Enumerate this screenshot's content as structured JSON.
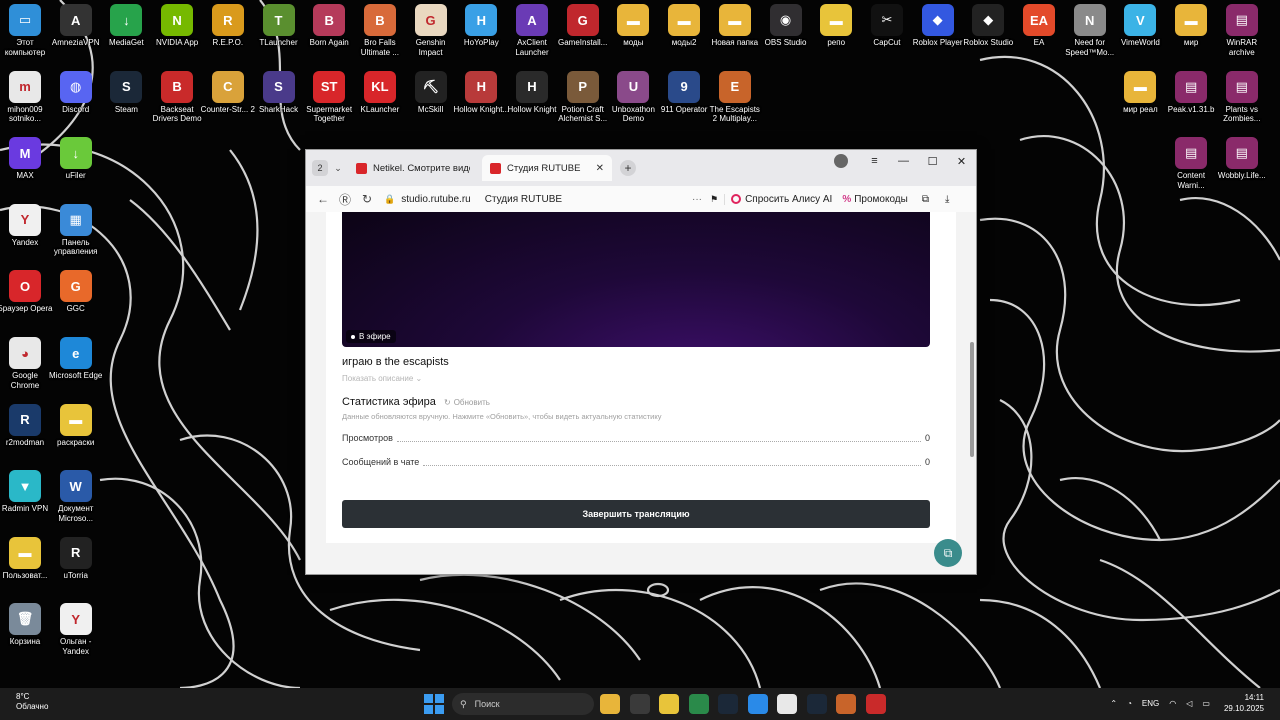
{
  "desktop_icons": [
    {
      "label": "Этот компьютер",
      "color": "#2f8fd8",
      "glyph": "▭",
      "col": 0,
      "row": 0
    },
    {
      "label": "AmneziaVPN",
      "color": "#333",
      "glyph": "A",
      "col": 1,
      "row": 0
    },
    {
      "label": "MediaGet",
      "color": "#27a34b",
      "glyph": "↓",
      "col": 2,
      "row": 0
    },
    {
      "label": "NVIDIA App",
      "color": "#76b900",
      "glyph": "N",
      "col": 3,
      "row": 0
    },
    {
      "label": "R.E.P.O.",
      "color": "#d99a1c",
      "glyph": "R",
      "col": 4,
      "row": 0
    },
    {
      "label": "TLauncher",
      "color": "#5a8f2f",
      "glyph": "T",
      "col": 5,
      "row": 0
    },
    {
      "label": "Born Again",
      "color": "#b53a5a",
      "glyph": "B",
      "col": 6,
      "row": 0
    },
    {
      "label": "Bro Falls Ultimate ...",
      "color": "#d86a3a",
      "glyph": "B",
      "col": 7,
      "row": 0
    },
    {
      "label": "Genshin Impact",
      "color": "#e9d8c0",
      "glyph": "G",
      "col": 8,
      "row": 0
    },
    {
      "label": "HoYoPlay",
      "color": "#39a0e6",
      "glyph": "H",
      "col": 9,
      "row": 0
    },
    {
      "label": "AxClient Launcher",
      "color": "#6a3bb5",
      "glyph": "A",
      "col": 10,
      "row": 0
    },
    {
      "label": "GameInstall...",
      "color": "#c0272d",
      "glyph": "G",
      "col": 11,
      "row": 0
    },
    {
      "label": "моды",
      "color": "#e8b53a",
      "glyph": "▬",
      "col": 12,
      "row": 0
    },
    {
      "label": "моды2",
      "color": "#e8b53a",
      "glyph": "▬",
      "col": 13,
      "row": 0
    },
    {
      "label": "Новая папка",
      "color": "#e8b53a",
      "glyph": "▬",
      "col": 14,
      "row": 0
    },
    {
      "label": "OBS Studio",
      "color": "#302e31",
      "glyph": "◉",
      "col": 15,
      "row": 0
    },
    {
      "label": "репо",
      "color": "#e8c43a",
      "glyph": "▬",
      "col": 16,
      "row": 0
    },
    {
      "label": "CapCut",
      "color": "#111",
      "glyph": "✂",
      "col": 17,
      "row": 0
    },
    {
      "label": "Roblox Player",
      "color": "#3358e0",
      "glyph": "◆",
      "col": 18,
      "row": 0
    },
    {
      "label": "Roblox Studio",
      "color": "#222",
      "glyph": "◆",
      "col": 19,
      "row": 0
    },
    {
      "label": "EA",
      "color": "#e34a2a",
      "glyph": "EA",
      "col": 20,
      "row": 0
    },
    {
      "label": "Need for Speed™Mo...",
      "color": "#8a8a8a",
      "glyph": "N",
      "col": 21,
      "row": 0
    },
    {
      "label": "VimeWorld",
      "color": "#3bb3e6",
      "glyph": "V",
      "col": 22,
      "row": 0
    },
    {
      "label": "мир",
      "color": "#e8b53a",
      "glyph": "▬",
      "col": 23,
      "row": 0
    },
    {
      "label": "WinRAR archive",
      "color": "#8a2a6a",
      "glyph": "▤",
      "col": 24,
      "row": 0
    },
    {
      "label": "mihon009 sotniko...",
      "color": "#e8e8e8",
      "glyph": "m",
      "col": 0,
      "row": 1
    },
    {
      "label": "Discord",
      "color": "#5865f2",
      "glyph": "◍",
      "col": 1,
      "row": 1
    },
    {
      "label": "Steam",
      "color": "#1b2838",
      "glyph": "S",
      "col": 2,
      "row": 1
    },
    {
      "label": "Backseat Drivers Demo",
      "color": "#c92a2a",
      "glyph": "B",
      "col": 3,
      "row": 1
    },
    {
      "label": "Counter-Str... 2",
      "color": "#d9a23a",
      "glyph": "C",
      "col": 4,
      "row": 1
    },
    {
      "label": "SharkHack",
      "color": "#4a3a8a",
      "glyph": "S",
      "col": 5,
      "row": 1
    },
    {
      "label": "Supermarket Together",
      "color": "#d8262a",
      "glyph": "ST",
      "col": 6,
      "row": 1
    },
    {
      "label": "KLauncher",
      "color": "#d8262a",
      "glyph": "KL",
      "col": 7,
      "row": 1
    },
    {
      "label": "McSkill",
      "color": "#222",
      "glyph": "⛏",
      "col": 8,
      "row": 1
    },
    {
      "label": "Hollow Knight...",
      "color": "#b83a3a",
      "glyph": "H",
      "col": 9,
      "row": 1
    },
    {
      "label": "Hollow Knight",
      "color": "#2a2a2a",
      "glyph": "H",
      "col": 10,
      "row": 1
    },
    {
      "label": "Potion Craft Alchemist S...",
      "color": "#7a5a3a",
      "glyph": "P",
      "col": 11,
      "row": 1
    },
    {
      "label": "Unboxathon Demo",
      "color": "#8a4a8a",
      "glyph": "U",
      "col": 12,
      "row": 1
    },
    {
      "label": "911 Operator",
      "color": "#2a4a8a",
      "glyph": "9",
      "col": 13,
      "row": 1
    },
    {
      "label": "The Escapists 2 Multiplay...",
      "color": "#c8642a",
      "glyph": "E",
      "col": 14,
      "row": 1
    },
    {
      "label": "мир реал",
      "color": "#e8b53a",
      "glyph": "▬",
      "col": 22,
      "row": 1
    },
    {
      "label": "Peak.v1.31.b",
      "color": "#8a2a6a",
      "glyph": "▤",
      "col": 23,
      "row": 1
    },
    {
      "label": "Plants vs Zombies...",
      "color": "#8a2a6a",
      "glyph": "▤",
      "col": 24,
      "row": 1
    },
    {
      "label": "MAX",
      "color": "#6a3ae0",
      "glyph": "M",
      "col": 0,
      "row": 2
    },
    {
      "label": "uFiler",
      "color": "#6ac93a",
      "glyph": "↓",
      "col": 1,
      "row": 2
    },
    {
      "label": "Content Warni...",
      "color": "#8a2a6a",
      "glyph": "▤",
      "col": 23,
      "row": 2
    },
    {
      "label": "Wobbly.Life...",
      "color": "#8a2a6a",
      "glyph": "▤",
      "col": 24,
      "row": 2
    },
    {
      "label": "Yandex",
      "color": "#f0f0f0",
      "glyph": "Y",
      "col": 0,
      "row": 3
    },
    {
      "label": "Панель управления",
      "color": "#3a8ad8",
      "glyph": "▦",
      "col": 1,
      "row": 3
    },
    {
      "label": "Браузер Opera",
      "color": "#d8262a",
      "glyph": "O",
      "col": 0,
      "row": 4
    },
    {
      "label": "GGC",
      "color": "#e8692a",
      "glyph": "G",
      "col": 1,
      "row": 4
    },
    {
      "label": "Google Chrome",
      "color": "#e8e8e8",
      "glyph": "◕",
      "col": 0,
      "row": 5
    },
    {
      "label": "Microsoft Edge",
      "color": "#1e88d8",
      "glyph": "e",
      "col": 1,
      "row": 5
    },
    {
      "label": "r2modman",
      "color": "#1a3a6a",
      "glyph": "R",
      "col": 0,
      "row": 6
    },
    {
      "label": "раскраски",
      "color": "#e8c43a",
      "glyph": "▬",
      "col": 1,
      "row": 6
    },
    {
      "label": "Radmin VPN",
      "color": "#2ab8c8",
      "glyph": "▼",
      "col": 0,
      "row": 7
    },
    {
      "label": "Документ Microso...",
      "color": "#2a5aa8",
      "glyph": "W",
      "col": 1,
      "row": 7
    },
    {
      "label": "Пользоват...",
      "color": "#e8c43a",
      "glyph": "▬",
      "col": 0,
      "row": 8
    },
    {
      "label": "uTorria",
      "color": "#222",
      "glyph": "R",
      "col": 1,
      "row": 8
    },
    {
      "label": "Корзина",
      "color": "#7a8a9a",
      "glyph": "🗑",
      "col": 0,
      "row": 9
    },
    {
      "label": "Ольган - Yandex",
      "color": "#f0f0f0",
      "glyph": "Y",
      "col": 1,
      "row": 9
    }
  ],
  "browser": {
    "tab_count": "2",
    "tabs": [
      {
        "label": "Netikel. Смотрите видео...",
        "active": false
      },
      {
        "label": "Студия RUTUBE",
        "active": true
      }
    ],
    "url_domain": "studio.rutube.ru",
    "page_title": "Студия RUTUBE",
    "alice_label": "Спросить Алису AI",
    "promo_label": "Промокоды",
    "nav": {
      "back": "←",
      "reader": "Ⓡ",
      "reload": "↻",
      "more": "···",
      "bookmark": "🔖"
    },
    "window_controls": {
      "menu": "≡",
      "minimize": "—",
      "maximize": "☐",
      "close": "✕"
    }
  },
  "studio": {
    "live_badge": "В эфире",
    "stream_title": "играю в the escapists",
    "show_description": "Показать описание",
    "stats_title": "Статистика эфира",
    "refresh_label": "Обновить",
    "stats_note": "Данные обновляются вручную. Нажмите «Обновить», чтобы видеть актуальную статистику",
    "stats": [
      {
        "label": "Просмотров",
        "value": "0"
      },
      {
        "label": "Сообщений в чате",
        "value": "0"
      }
    ],
    "end_button": "Завершить трансляцию"
  },
  "taskbar": {
    "weather_temp": "8°C",
    "weather_desc": "Облачно",
    "search_placeholder": "Поиск",
    "lang": "ENG",
    "time": "14:11",
    "date": "29.10.2025",
    "app_colors": [
      "#e8b53a",
      "#3a3a3a",
      "#e8c43a",
      "#2a8a4a",
      "#1b2838",
      "#2a8ae8",
      "#e8e8e8",
      "#1b2838",
      "#c8642a",
      "#c92a2a"
    ]
  }
}
